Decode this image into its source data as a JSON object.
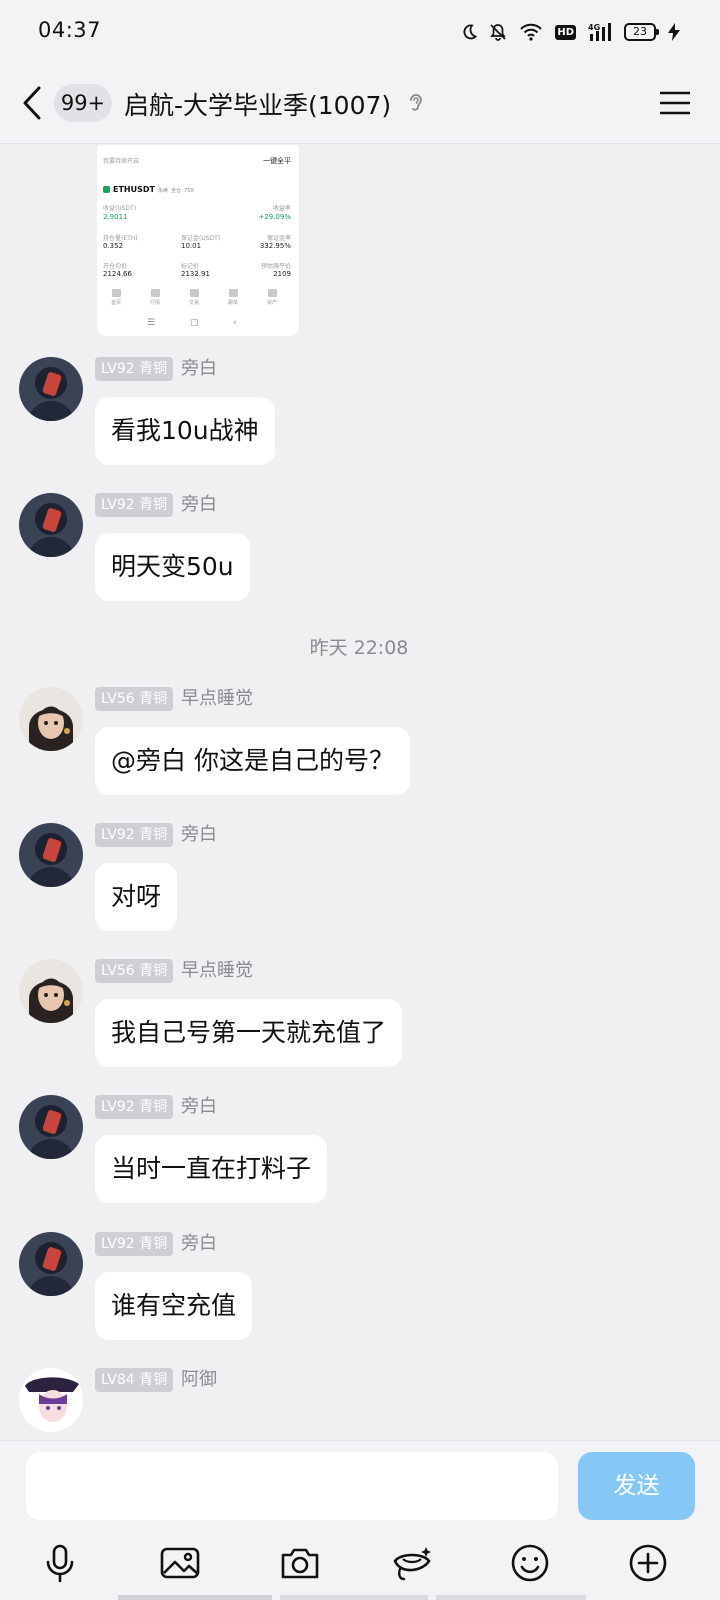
{
  "status_bar": {
    "time": "04:37",
    "icons": [
      "moon-icon",
      "bell-muted-icon",
      "wifi-icon",
      "hd-icon",
      "signal-4g-icon",
      "battery-icon",
      "charging-icon"
    ],
    "hd": "HD",
    "network": "4G",
    "battery": "23"
  },
  "header": {
    "back_icon": "chevron-left-icon",
    "unread_badge": "99+",
    "title": "启航-大学毕业季(1007)",
    "ear_icon": "ear-icon",
    "menu_icon": "hamburger-menu-icon"
  },
  "shared_screenshot": {
    "hint": "我要持续开启",
    "action": "一键全平",
    "pair": "ETHUSDT",
    "pair_tags": [
      "永续",
      "全仓",
      "75X"
    ],
    "stats": [
      {
        "label": "收益(USDT)",
        "value": "2.9011"
      },
      {
        "label": "收益率",
        "value": "+29.09%"
      },
      {
        "label": "持仓量(ETH)",
        "value": "0.352"
      },
      {
        "label": "保证金(USDT)",
        "value": "10.01"
      },
      {
        "label": "保证金率",
        "value": "332.95%"
      },
      {
        "label": "开仓均价",
        "value": "2124.66"
      },
      {
        "label": "标记价",
        "value": "2132.91"
      },
      {
        "label": "预估强平价",
        "value": "2109"
      }
    ],
    "bottom_nav": [
      "首页",
      "行情",
      "交易",
      "跟单",
      "资产"
    ]
  },
  "messages": [
    {
      "level": "LV92 青铜",
      "name": "旁白",
      "text": "看我10u战神"
    },
    {
      "level": "LV92 青铜",
      "name": "旁白",
      "text": "明天变50u"
    },
    {
      "level": "LV56 青铜",
      "name": "早点睡觉",
      "text": "@旁白 你这是自己的号？"
    },
    {
      "level": "LV92 青铜",
      "name": "旁白",
      "text": "对呀"
    },
    {
      "level": "LV56 青铜",
      "name": "早点睡觉",
      "text": "我自己号第一天就充值了"
    },
    {
      "level": "LV92 青铜",
      "name": "旁白",
      "text": "当时一直在打料子"
    },
    {
      "level": "LV92 青铜",
      "name": "旁白",
      "text": "谁有空充值"
    },
    {
      "level": "LV84 青铜",
      "name": "阿御",
      "text": ""
    }
  ],
  "timestamp": "昨天 22:08",
  "input": {
    "placeholder": "",
    "send_label": "发送",
    "toolbar": [
      "microphone-icon",
      "image-icon",
      "camera-icon",
      "red-packet-icon",
      "emoji-icon",
      "plus-icon"
    ]
  },
  "colors": {
    "background": "#f0f0f3",
    "bubble": "#ffffff",
    "level_badge": "#cfcfd3",
    "send_button": "#86c8f5",
    "name_text": "#8b8b8f"
  }
}
